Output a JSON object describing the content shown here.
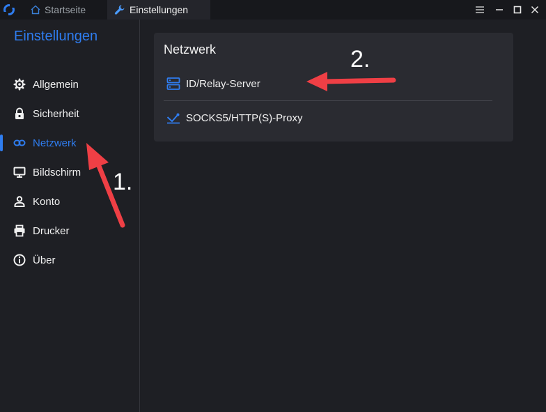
{
  "titlebar": {
    "tabs": [
      {
        "label": "Startseite",
        "icon": "home-icon"
      },
      {
        "label": "Einstellungen",
        "icon": "wrench-icon"
      }
    ],
    "window_controls": [
      "menu-icon",
      "minimize-icon",
      "maximize-icon",
      "close-icon"
    ]
  },
  "sidebar": {
    "title": "Einstellungen",
    "items": [
      {
        "label": "Allgemein",
        "icon": "gear-icon"
      },
      {
        "label": "Sicherheit",
        "icon": "lock-icon"
      },
      {
        "label": "Netzwerk",
        "icon": "link-icon",
        "active": true
      },
      {
        "label": "Bildschirm",
        "icon": "monitor-icon"
      },
      {
        "label": "Konto",
        "icon": "user-icon"
      },
      {
        "label": "Drucker",
        "icon": "printer-icon"
      },
      {
        "label": "Über",
        "icon": "info-icon"
      }
    ]
  },
  "main": {
    "card_title": "Netzwerk",
    "items": [
      {
        "label": "ID/Relay-Server",
        "icon": "server-icon"
      },
      {
        "label": "SOCKS5/HTTP(S)-Proxy",
        "icon": "proxy-icon"
      }
    ]
  },
  "annotations": {
    "step1": "1.",
    "step2": "2."
  },
  "colors": {
    "accent": "#2f7df0",
    "arrow": "#ef3f45",
    "background": "#1e1f24",
    "card": "#2a2b31"
  }
}
